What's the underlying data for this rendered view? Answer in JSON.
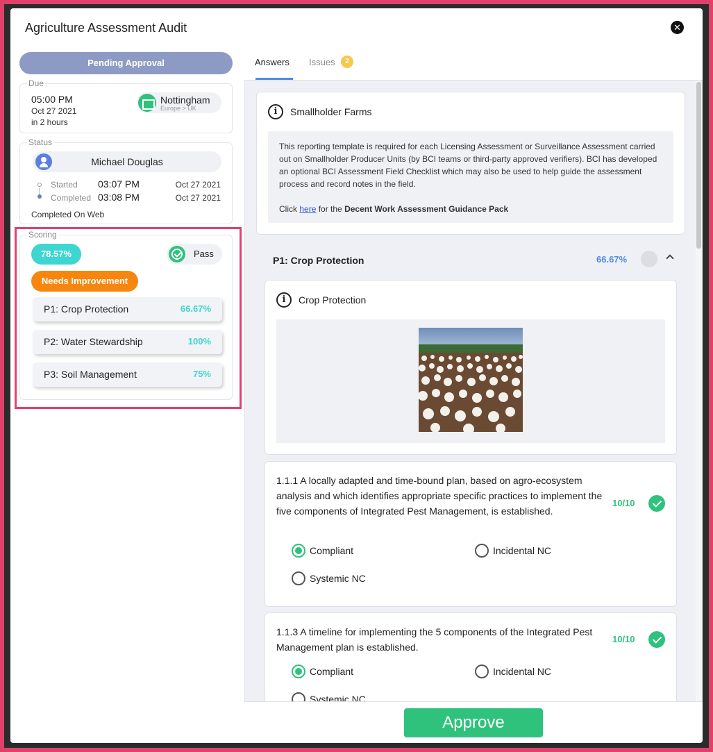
{
  "modal": {
    "title": "Agriculture Assessment Audit"
  },
  "left": {
    "status_banner": "Pending Approval",
    "due": {
      "legend": "Due",
      "time": "05:00 PM",
      "date": "Oct 27 2021",
      "relative": "in 2 hours",
      "location_name": "Nottingham",
      "location_region": "Europe > UK"
    },
    "status": {
      "legend": "Status",
      "user": "Michael Douglas",
      "started_label": "Started",
      "started_time": "03:07 PM",
      "started_date": "Oct 27 2021",
      "completed_label": "Completed",
      "completed_time": "03:08 PM",
      "completed_date": "Oct 27 2021",
      "completed_via": "Completed On Web"
    },
    "scoring": {
      "legend": "Scoring",
      "score": "78.57%",
      "result": "Pass",
      "rating": "Needs Improvement",
      "sections": [
        {
          "name": "P1: Crop Protection",
          "pct": "66.67%"
        },
        {
          "name": "P2: Water Stewardship",
          "pct": "100%"
        },
        {
          "name": "P3: Soil Management",
          "pct": "75%"
        }
      ]
    }
  },
  "tabs": {
    "answers": "Answers",
    "issues": "Issues",
    "issues_count": "2"
  },
  "intro": {
    "title": "Smallholder Farms",
    "description": "This reporting template is required for each Licensing Assessment or Surveillance Assessment carried out on Smallholder Producer Units (by BCI teams or third-party approved verifiers). BCI has developed an optional BCI Assessment Field Checklist which may also be used to help guide the assessment process and record notes in the field.",
    "click_prefix": "Click ",
    "link_text": "here",
    "click_middle": " for the ",
    "guidance_pack": "Decent Work Assessment Guidance Pack"
  },
  "section": {
    "title": "P1: Crop Protection",
    "pct": "66.67%",
    "image_card_title": "Crop Protection"
  },
  "questions": [
    {
      "text": "1.1.1 A locally adapted and time-bound plan, based on agro-ecosystem analysis and which identifies appropriate specific practices to implement the five components of Integrated Pest Management, is established.",
      "score": "10/10",
      "options": [
        "Compliant",
        "Incidental NC",
        "Systemic NC"
      ],
      "selected": "Compliant"
    },
    {
      "text": "1.1.3 A timeline for implementing the 5 components of the Integrated Pest Management plan is established.",
      "score": "10/10",
      "options": [
        "Compliant",
        "Incidental NC",
        "Systemic NC"
      ],
      "selected": "Compliant"
    }
  ],
  "footer": {
    "approve": "Approve"
  },
  "colors": {
    "accent_green": "#2fc27c",
    "accent_teal": "#3dd6d0",
    "accent_orange": "#f7860f",
    "accent_blue": "#4f8ae0",
    "pending": "#8d9bc4",
    "highlight": "#e0416a"
  }
}
